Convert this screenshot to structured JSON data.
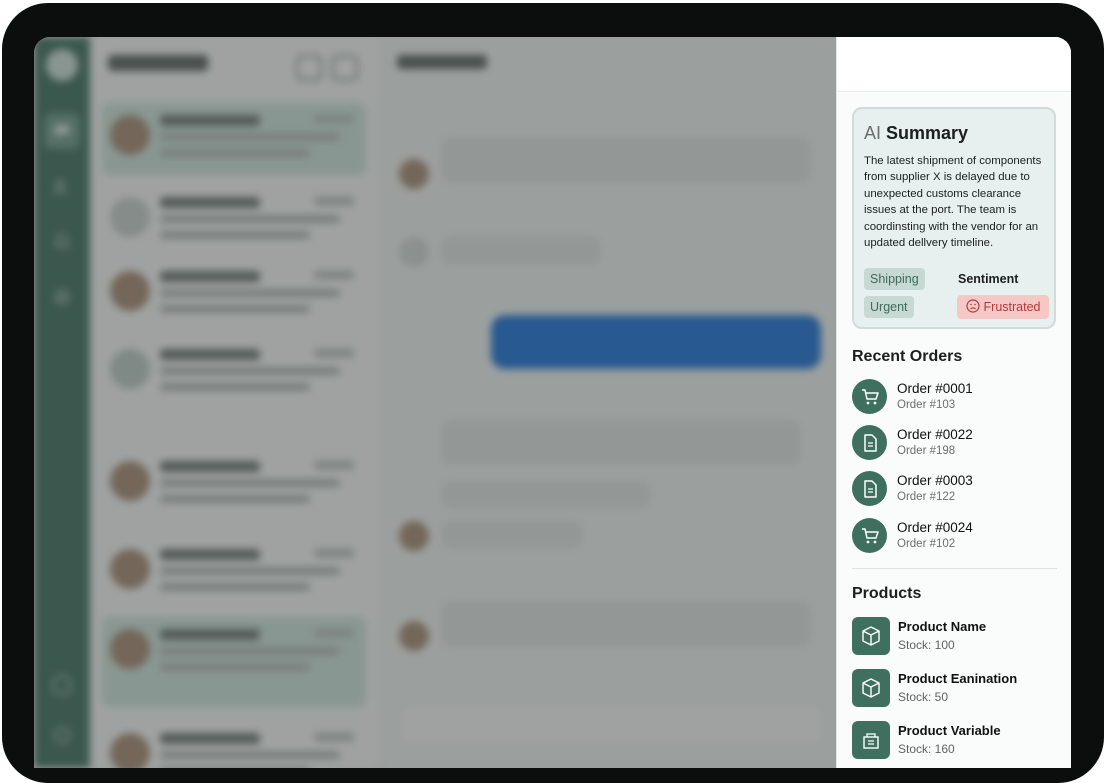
{
  "summary": {
    "ai_label": "AI",
    "title_word": "Summary",
    "text": "The latest shipment of components from supplier X is delayed due to unexpected customs clearance issues at the port. The team is coordinsting with the vendor for an updated dellvery timeline.",
    "tags": [
      "Shipping",
      "Urgent"
    ],
    "sentiment_label": "Sentiment",
    "sentiment_value": "Frustrated"
  },
  "recent_orders": {
    "title": "Recent Orders",
    "items": [
      {
        "name": "Order #0001",
        "sub": "Order #103",
        "icon": "cart-icon"
      },
      {
        "name": "Order #0022",
        "sub": "Order #198",
        "icon": "document-icon"
      },
      {
        "name": "Order #0003",
        "sub": "Order #122",
        "icon": "document-icon"
      },
      {
        "name": "Order #0024",
        "sub": "Order #102",
        "icon": "cart-icon"
      }
    ]
  },
  "products": {
    "title": "Products",
    "items": [
      {
        "name": "Product Name",
        "stock": "Stock: 100",
        "icon": "box-icon"
      },
      {
        "name": "Product Eanination",
        "stock": "Stock: 50",
        "icon": "box-icon"
      },
      {
        "name": "Product Variable",
        "stock": "Stock: 160",
        "icon": "package-icon"
      }
    ]
  },
  "colors": {
    "brand": "#3f6f5f",
    "tag_bg": "#c7d9d3",
    "sentiment_bg": "#f6c8c5",
    "message_blue": "#1c71d8"
  }
}
